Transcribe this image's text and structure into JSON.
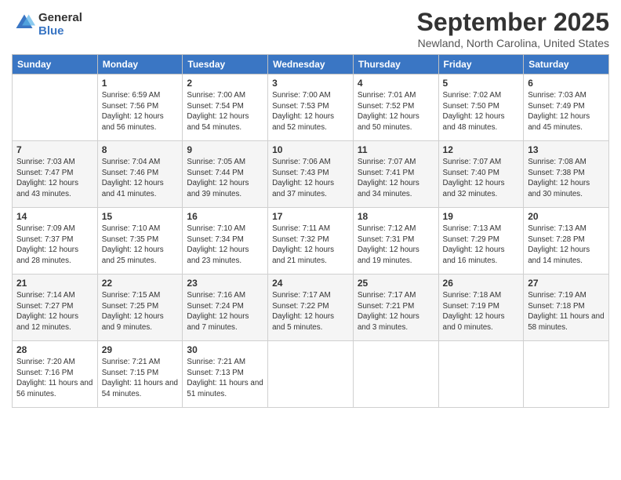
{
  "header": {
    "logo_line1": "General",
    "logo_line2": "Blue",
    "month_title": "September 2025",
    "location": "Newland, North Carolina, United States"
  },
  "weekdays": [
    "Sunday",
    "Monday",
    "Tuesday",
    "Wednesday",
    "Thursday",
    "Friday",
    "Saturday"
  ],
  "weeks": [
    [
      {
        "day": "",
        "sunrise": "",
        "sunset": "",
        "daylight": ""
      },
      {
        "day": "1",
        "sunrise": "Sunrise: 6:59 AM",
        "sunset": "Sunset: 7:56 PM",
        "daylight": "Daylight: 12 hours and 56 minutes."
      },
      {
        "day": "2",
        "sunrise": "Sunrise: 7:00 AM",
        "sunset": "Sunset: 7:54 PM",
        "daylight": "Daylight: 12 hours and 54 minutes."
      },
      {
        "day": "3",
        "sunrise": "Sunrise: 7:00 AM",
        "sunset": "Sunset: 7:53 PM",
        "daylight": "Daylight: 12 hours and 52 minutes."
      },
      {
        "day": "4",
        "sunrise": "Sunrise: 7:01 AM",
        "sunset": "Sunset: 7:52 PM",
        "daylight": "Daylight: 12 hours and 50 minutes."
      },
      {
        "day": "5",
        "sunrise": "Sunrise: 7:02 AM",
        "sunset": "Sunset: 7:50 PM",
        "daylight": "Daylight: 12 hours and 48 minutes."
      },
      {
        "day": "6",
        "sunrise": "Sunrise: 7:03 AM",
        "sunset": "Sunset: 7:49 PM",
        "daylight": "Daylight: 12 hours and 45 minutes."
      }
    ],
    [
      {
        "day": "7",
        "sunrise": "Sunrise: 7:03 AM",
        "sunset": "Sunset: 7:47 PM",
        "daylight": "Daylight: 12 hours and 43 minutes."
      },
      {
        "day": "8",
        "sunrise": "Sunrise: 7:04 AM",
        "sunset": "Sunset: 7:46 PM",
        "daylight": "Daylight: 12 hours and 41 minutes."
      },
      {
        "day": "9",
        "sunrise": "Sunrise: 7:05 AM",
        "sunset": "Sunset: 7:44 PM",
        "daylight": "Daylight: 12 hours and 39 minutes."
      },
      {
        "day": "10",
        "sunrise": "Sunrise: 7:06 AM",
        "sunset": "Sunset: 7:43 PM",
        "daylight": "Daylight: 12 hours and 37 minutes."
      },
      {
        "day": "11",
        "sunrise": "Sunrise: 7:07 AM",
        "sunset": "Sunset: 7:41 PM",
        "daylight": "Daylight: 12 hours and 34 minutes."
      },
      {
        "day": "12",
        "sunrise": "Sunrise: 7:07 AM",
        "sunset": "Sunset: 7:40 PM",
        "daylight": "Daylight: 12 hours and 32 minutes."
      },
      {
        "day": "13",
        "sunrise": "Sunrise: 7:08 AM",
        "sunset": "Sunset: 7:38 PM",
        "daylight": "Daylight: 12 hours and 30 minutes."
      }
    ],
    [
      {
        "day": "14",
        "sunrise": "Sunrise: 7:09 AM",
        "sunset": "Sunset: 7:37 PM",
        "daylight": "Daylight: 12 hours and 28 minutes."
      },
      {
        "day": "15",
        "sunrise": "Sunrise: 7:10 AM",
        "sunset": "Sunset: 7:35 PM",
        "daylight": "Daylight: 12 hours and 25 minutes."
      },
      {
        "day": "16",
        "sunrise": "Sunrise: 7:10 AM",
        "sunset": "Sunset: 7:34 PM",
        "daylight": "Daylight: 12 hours and 23 minutes."
      },
      {
        "day": "17",
        "sunrise": "Sunrise: 7:11 AM",
        "sunset": "Sunset: 7:32 PM",
        "daylight": "Daylight: 12 hours and 21 minutes."
      },
      {
        "day": "18",
        "sunrise": "Sunrise: 7:12 AM",
        "sunset": "Sunset: 7:31 PM",
        "daylight": "Daylight: 12 hours and 19 minutes."
      },
      {
        "day": "19",
        "sunrise": "Sunrise: 7:13 AM",
        "sunset": "Sunset: 7:29 PM",
        "daylight": "Daylight: 12 hours and 16 minutes."
      },
      {
        "day": "20",
        "sunrise": "Sunrise: 7:13 AM",
        "sunset": "Sunset: 7:28 PM",
        "daylight": "Daylight: 12 hours and 14 minutes."
      }
    ],
    [
      {
        "day": "21",
        "sunrise": "Sunrise: 7:14 AM",
        "sunset": "Sunset: 7:27 PM",
        "daylight": "Daylight: 12 hours and 12 minutes."
      },
      {
        "day": "22",
        "sunrise": "Sunrise: 7:15 AM",
        "sunset": "Sunset: 7:25 PM",
        "daylight": "Daylight: 12 hours and 9 minutes."
      },
      {
        "day": "23",
        "sunrise": "Sunrise: 7:16 AM",
        "sunset": "Sunset: 7:24 PM",
        "daylight": "Daylight: 12 hours and 7 minutes."
      },
      {
        "day": "24",
        "sunrise": "Sunrise: 7:17 AM",
        "sunset": "Sunset: 7:22 PM",
        "daylight": "Daylight: 12 hours and 5 minutes."
      },
      {
        "day": "25",
        "sunrise": "Sunrise: 7:17 AM",
        "sunset": "Sunset: 7:21 PM",
        "daylight": "Daylight: 12 hours and 3 minutes."
      },
      {
        "day": "26",
        "sunrise": "Sunrise: 7:18 AM",
        "sunset": "Sunset: 7:19 PM",
        "daylight": "Daylight: 12 hours and 0 minutes."
      },
      {
        "day": "27",
        "sunrise": "Sunrise: 7:19 AM",
        "sunset": "Sunset: 7:18 PM",
        "daylight": "Daylight: 11 hours and 58 minutes."
      }
    ],
    [
      {
        "day": "28",
        "sunrise": "Sunrise: 7:20 AM",
        "sunset": "Sunset: 7:16 PM",
        "daylight": "Daylight: 11 hours and 56 minutes."
      },
      {
        "day": "29",
        "sunrise": "Sunrise: 7:21 AM",
        "sunset": "Sunset: 7:15 PM",
        "daylight": "Daylight: 11 hours and 54 minutes."
      },
      {
        "day": "30",
        "sunrise": "Sunrise: 7:21 AM",
        "sunset": "Sunset: 7:13 PM",
        "daylight": "Daylight: 11 hours and 51 minutes."
      },
      {
        "day": "",
        "sunrise": "",
        "sunset": "",
        "daylight": ""
      },
      {
        "day": "",
        "sunrise": "",
        "sunset": "",
        "daylight": ""
      },
      {
        "day": "",
        "sunrise": "",
        "sunset": "",
        "daylight": ""
      },
      {
        "day": "",
        "sunrise": "",
        "sunset": "",
        "daylight": ""
      }
    ]
  ]
}
